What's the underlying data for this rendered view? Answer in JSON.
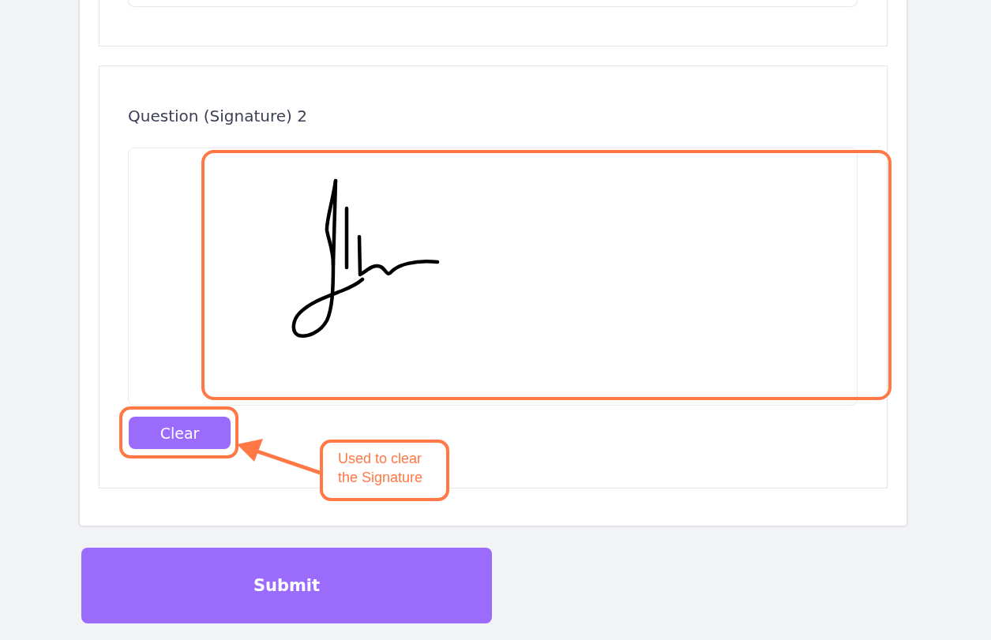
{
  "question": {
    "label": "Question (Signature) 2",
    "clear_button": "Clear"
  },
  "annotations": [
    {
      "kind": "frame"
    },
    {
      "kind": "frame"
    },
    {
      "kind": "callout",
      "text": "Used to clear the Signature"
    }
  ],
  "submit_button": "Submit"
}
